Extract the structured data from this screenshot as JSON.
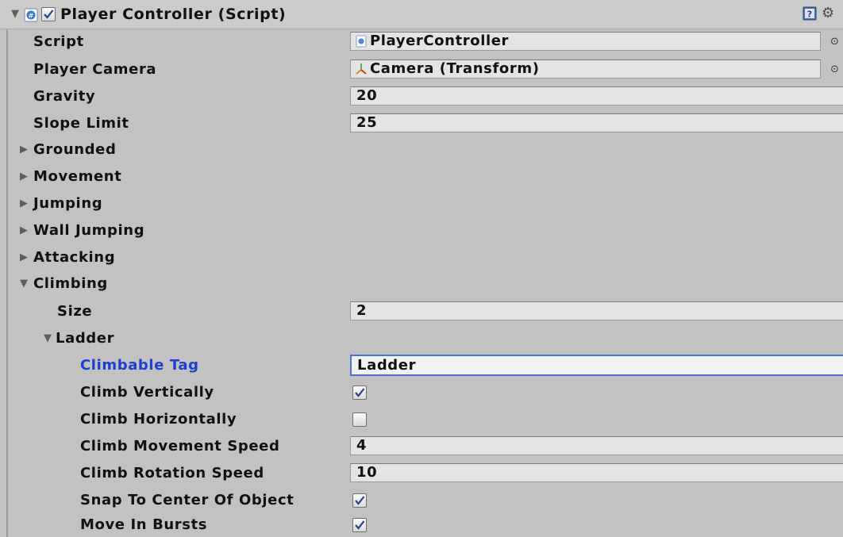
{
  "component": {
    "title": "Player Controller (Script)",
    "enabled": true
  },
  "fields": {
    "script": {
      "label": "Script",
      "value": "PlayerController"
    },
    "player_camera": {
      "label": "Player Camera",
      "value": "Camera (Transform)"
    },
    "gravity": {
      "label": "Gravity",
      "value": "20"
    },
    "slope_limit": {
      "label": "Slope Limit",
      "value": "25"
    }
  },
  "foldouts": {
    "grounded": "Grounded",
    "movement": "Movement",
    "jumping": "Jumping",
    "wall_jumping": "Wall Jumping",
    "attacking": "Attacking",
    "climbing": "Climbing"
  },
  "climbing": {
    "size_label": "Size",
    "size_value": "2",
    "ladder_label": "Ladder",
    "ladder": {
      "climbable_tag": {
        "label": "Climbable Tag",
        "value": "Ladder"
      },
      "climb_vertically": {
        "label": "Climb Vertically",
        "checked": true
      },
      "climb_horizontally": {
        "label": "Climb Horizontally",
        "checked": false
      },
      "climb_movement_speed": {
        "label": "Climb Movement Speed",
        "value": "4"
      },
      "climb_rotation_speed": {
        "label": "Climb Rotation Speed",
        "value": "10"
      },
      "snap_to_center": {
        "label": "Snap To Center Of Object",
        "checked": true
      },
      "move_in_bursts": {
        "label": "Move In Bursts",
        "checked": true
      }
    }
  },
  "icons": {
    "foldout_collapsed": "triangle-right-icon",
    "foldout_expanded": "triangle-down-icon",
    "script": "csharp-script-icon",
    "transform": "transform-axes-icon",
    "object_picker": "object-picker-icon",
    "help": "help-book-icon",
    "settings": "gear-icon"
  },
  "colors": {
    "panel_bg": "#c2c2c2",
    "active_label": "#1c3fd0",
    "focus_border": "#4d73cc"
  }
}
